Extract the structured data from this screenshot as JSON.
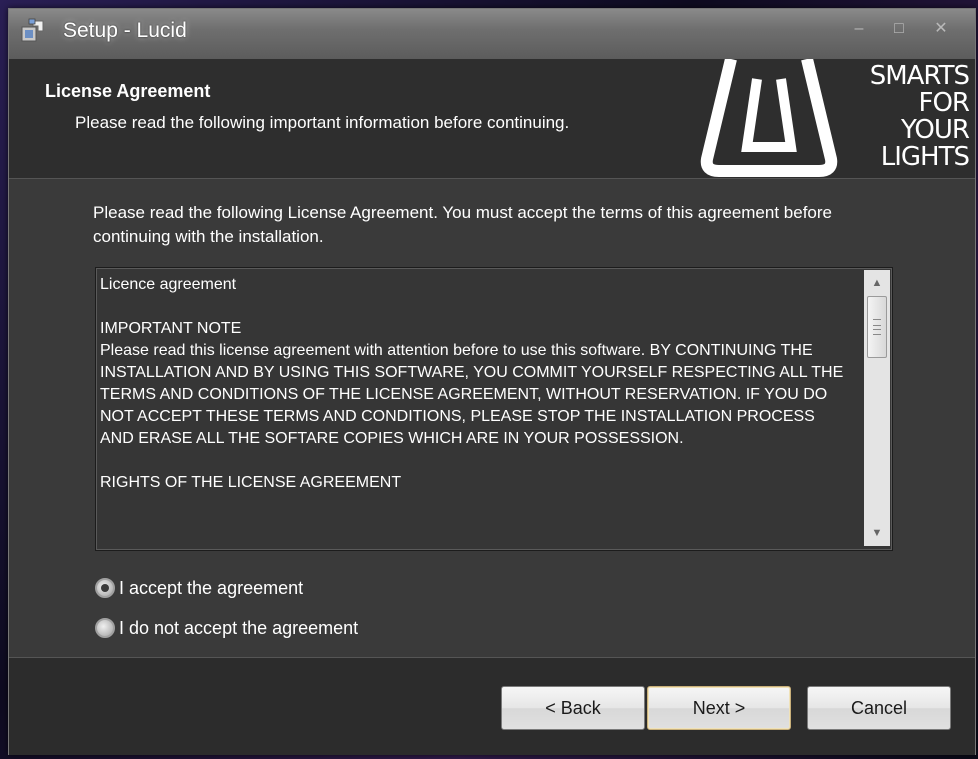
{
  "window": {
    "title": "Setup - Lucid",
    "icon": "setup-installer-icon",
    "controls": [
      "minimize-icon",
      "maximize-icon",
      "close-icon"
    ]
  },
  "header": {
    "title": "License Agreement",
    "subtitle": "Please read the following important information before continuing.",
    "logo": {
      "line1": "SMARTS",
      "line2": "FOR",
      "line3": "YOUR",
      "line4": "LIGHTS"
    }
  },
  "intro": "Please read the following License Agreement. You must accept the terms of this agreement before continuing with the installation.",
  "license_text": "Licence agreement\n\nIMPORTANT NOTE\nPlease read this license agreement with attention before to use this software. BY CONTINUING THE INSTALLATION AND BY USING THIS SOFTWARE, YOU COMMIT YOURSELF RESPECTING ALL THE TERMS AND CONDITIONS OF THE LICENSE AGREEMENT, WITHOUT RESERVATION. IF YOU DO NOT ACCEPT THESE TERMS AND CONDITIONS, PLEASE STOP THE INSTALLATION PROCESS AND ERASE ALL THE SOFTARE COPIES WHICH ARE IN YOUR POSSESSION.\n\nRIGHTS OF THE LICENSE AGREEMENT",
  "scrollbar": {
    "up_icon": "▲",
    "down_icon": "▼"
  },
  "options": {
    "accept_label": "I accept the agreement",
    "decline_label": "I do not accept the agreement",
    "selected": "accept"
  },
  "buttons": {
    "back": "< Back",
    "next": "Next >",
    "cancel": "Cancel"
  },
  "colors": {
    "panel": "#3a3a3a",
    "header": "#2e2e2e",
    "text": "#ffffff"
  }
}
